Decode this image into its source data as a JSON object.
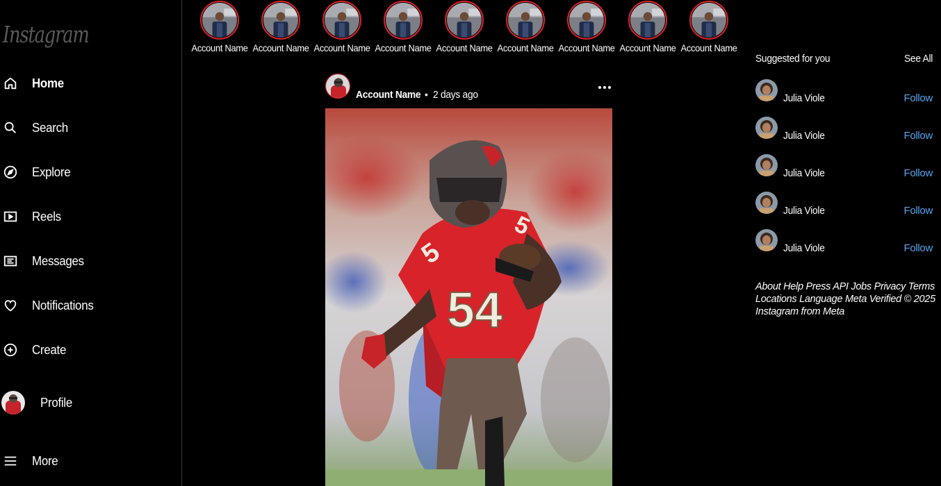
{
  "app": {
    "logo_text": "Instagram"
  },
  "sidebar": {
    "items": [
      {
        "label": "Home",
        "icon": "home-icon",
        "bold": true
      },
      {
        "label": "Search",
        "icon": "search-icon"
      },
      {
        "label": "Explore",
        "icon": "compass-icon"
      },
      {
        "label": "Reels",
        "icon": "reels-icon"
      },
      {
        "label": "Messages",
        "icon": "messages-icon"
      },
      {
        "label": "Notifications",
        "icon": "heart-icon"
      },
      {
        "label": "Create",
        "icon": "plus-circle-icon"
      },
      {
        "label": "Profile",
        "icon": "profile-avatar"
      },
      {
        "label": "More",
        "icon": "menu-icon"
      }
    ]
  },
  "stories": [
    {
      "name": "Account Name"
    },
    {
      "name": "Account Name"
    },
    {
      "name": "Account Name"
    },
    {
      "name": "Account Name"
    },
    {
      "name": "Account Name"
    },
    {
      "name": "Account Name"
    },
    {
      "name": "Account Name"
    },
    {
      "name": "Account Name"
    },
    {
      "name": "Account Name"
    }
  ],
  "post": {
    "account_name": "Account Name",
    "separator": "•",
    "time": "2 days ago",
    "jersey_number": "54"
  },
  "suggestions": {
    "title": "Suggested for you",
    "see_all": "See All",
    "users": [
      {
        "name": "Julia Viole",
        "action": "Follow"
      },
      {
        "name": "Julia Viole",
        "action": "Follow"
      },
      {
        "name": "Julia Viole",
        "action": "Follow"
      },
      {
        "name": "Julia Viole",
        "action": "Follow"
      },
      {
        "name": "Julia Viole",
        "action": "Follow"
      }
    ]
  },
  "footer": {
    "text": "About Help Press API Jobs Privacy Terms Locations Language Meta Verified © 2025 Instagram from Meta"
  },
  "colors": {
    "background": "#000000",
    "story_ring": "#e0242b",
    "follow_link": "#58a6f2",
    "jersey_red": "#d8232a"
  }
}
